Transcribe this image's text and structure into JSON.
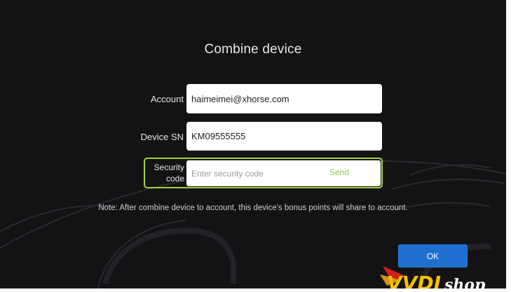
{
  "dialog": {
    "title": "Combine device",
    "account_label": "Account",
    "account_value": "haimeimei@xhorse.com",
    "device_sn_label": "Device SN",
    "device_sn_value": "KM09555555",
    "security_label_line1": "Security",
    "security_label_line2": "code",
    "security_placeholder": "Enter security code",
    "send_label": "Send",
    "note": "Note: After combine device to account, this device's bonus points will share to account.",
    "ok_label": "OK"
  },
  "watermark": {
    "text": "VVDIshop"
  },
  "colors": {
    "background": "#131315",
    "accent_green": "#a6d23a",
    "ok_blue": "#1e6fd0"
  }
}
